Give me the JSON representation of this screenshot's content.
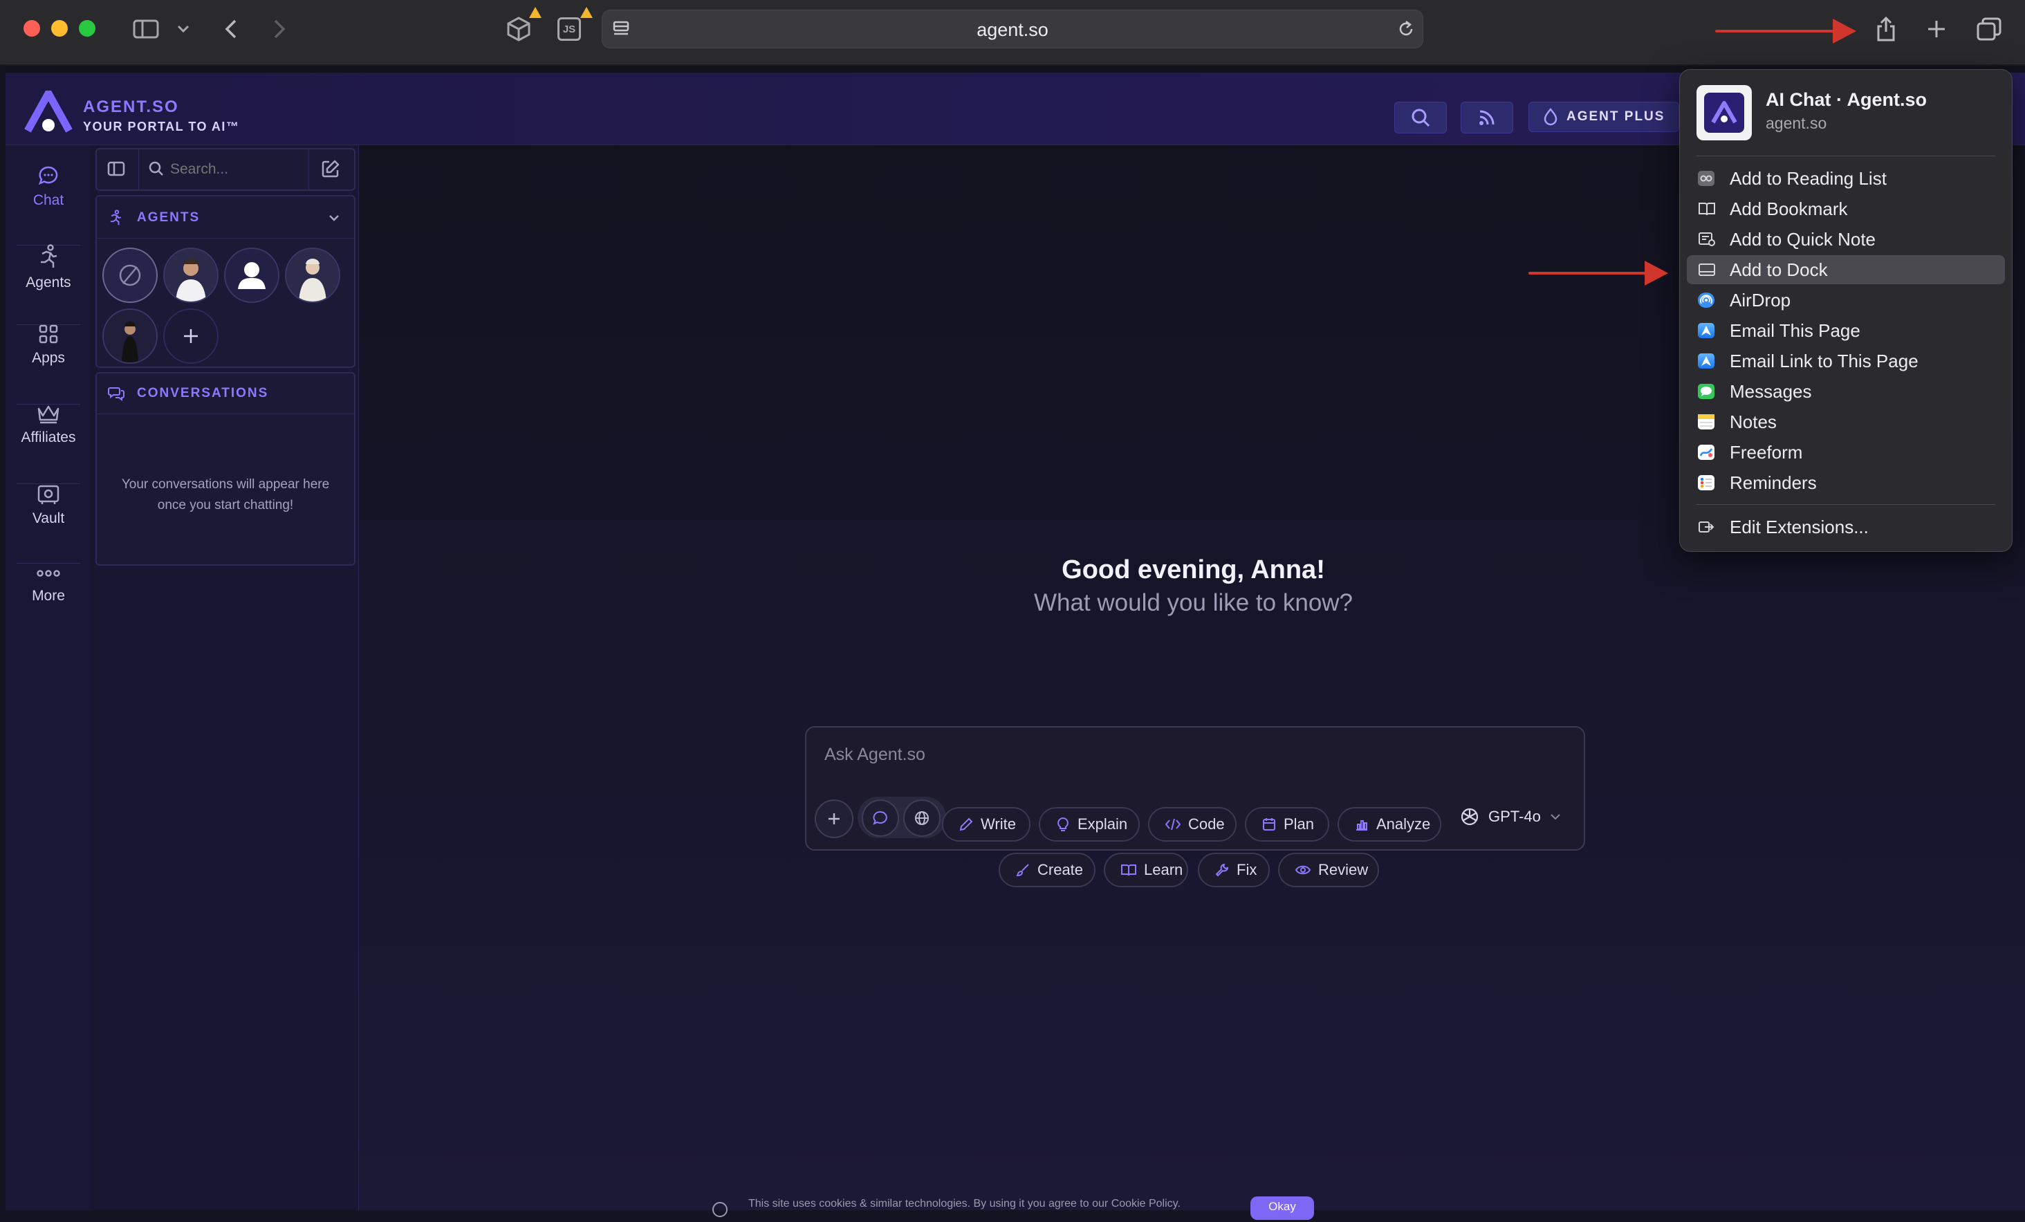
{
  "browser": {
    "address": "agent.so",
    "ext_js_label": "JS"
  },
  "app": {
    "brand_name": "AGENT.SO",
    "brand_tagline": "YOUR PORTAL TO AI™",
    "plus_label": "AGENT PLUS",
    "accent": "#8c79ff"
  },
  "rail": {
    "chat": "Chat",
    "agents": "Agents",
    "apps": "Apps",
    "affiliates": "Affiliates",
    "vault": "Vault",
    "more": "More"
  },
  "panel": {
    "search_placeholder": "Search...",
    "agents_title": "AGENTS",
    "conversations_title": "CONVERSATIONS",
    "empty_text": "Your conversations will appear here once you start chatting!"
  },
  "main": {
    "greeting": "Good evening, Anna!",
    "subtitle": "What would you like to know?",
    "ask_placeholder": "Ask Agent.so",
    "model": "GPT-4o",
    "chips_row1": [
      "Write",
      "Explain",
      "Code",
      "Plan",
      "Analyze"
    ],
    "chips_row2": [
      "Create",
      "Learn",
      "Fix",
      "Review"
    ]
  },
  "cookie": {
    "text": "This site uses cookies & similar technologies. By using it you agree to our Cookie Policy.",
    "button": "Okay"
  },
  "share_menu": {
    "title": "AI Chat · Agent.so",
    "url": "agent.so",
    "items": [
      {
        "label": "Add to Reading List",
        "icon": "reading-list-icon"
      },
      {
        "label": "Add Bookmark",
        "icon": "book-icon"
      },
      {
        "label": "Add to Quick Note",
        "icon": "quick-note-icon"
      },
      {
        "label": "Add to Dock",
        "icon": "dock-icon",
        "highlighted": true
      },
      {
        "label": "AirDrop",
        "icon": "airdrop-icon"
      },
      {
        "label": "Email This Page",
        "icon": "mail-icon"
      },
      {
        "label": "Email Link to This Page",
        "icon": "mail-icon"
      },
      {
        "label": "Messages",
        "icon": "messages-icon"
      },
      {
        "label": "Notes",
        "icon": "notes-icon"
      },
      {
        "label": "Freeform",
        "icon": "freeform-icon"
      },
      {
        "label": "Reminders",
        "icon": "reminders-icon"
      }
    ],
    "edit_label": "Edit Extensions..."
  }
}
